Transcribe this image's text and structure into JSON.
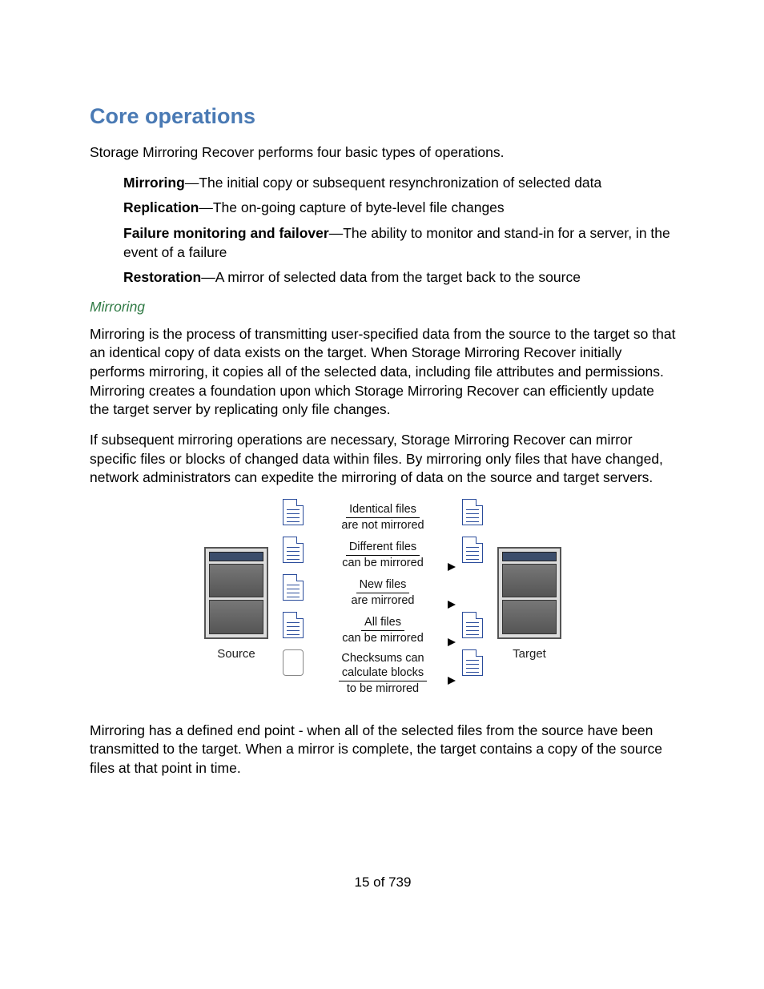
{
  "heading": "Core operations",
  "intro": "Storage Mirroring Recover performs four basic types of operations.",
  "definitions": [
    {
      "term": "Mirroring",
      "desc": "—The initial copy or subsequent resynchronization of selected data"
    },
    {
      "term": "Replication",
      "desc": "—The on-going capture of byte-level file changes"
    },
    {
      "term": "Failure monitoring and failover",
      "desc": "—The ability to monitor and stand-in for a server, in the event of a failure"
    },
    {
      "term": "Restoration",
      "desc": "—A mirror of selected data from the target back to the source"
    }
  ],
  "sub_heading": "Mirroring",
  "para1": "Mirroring is the process of transmitting user-specified data from the source to the target so that an identical copy of data exists on the target. When Storage Mirroring Recover initially performs mirroring, it copies all of the selected data, including file attributes and permissions. Mirroring creates a foundation upon which Storage Mirroring Recover can efficiently update the target server by replicating only file changes.",
  "para2": "If subsequent mirroring operations are necessary, Storage Mirroring Recover can mirror specific files or blocks of changed data within files. By mirroring only files that have changed, network administrators can expedite the mirroring of data on the source and target servers.",
  "diagram": {
    "source_label": "Source",
    "target_label": "Target",
    "rows": [
      {
        "l1": "Identical files",
        "l2": "are not mirrored",
        "arrow": false,
        "left": "file",
        "right": "file"
      },
      {
        "l1": "Different files",
        "l2": "can be mirrored",
        "arrow": true,
        "left": "file",
        "right": "file"
      },
      {
        "l1": "New files",
        "l2": "are mirrored",
        "arrow": true,
        "left": "file",
        "right": "none"
      },
      {
        "l1": "All files",
        "l2": "can be mirrored",
        "arrow": true,
        "left": "file",
        "right": "file"
      },
      {
        "l1": "Checksums can",
        "l2": "calculate blocks",
        "l3": "to be mirrored",
        "arrow": true,
        "left": "blank",
        "right": "file"
      }
    ]
  },
  "para3": "Mirroring has a defined end point - when all of the selected files from the source have been transmitted to the target. When a mirror is complete, the target contains a copy of the source files at that point in time.",
  "footer": "15 of 739"
}
